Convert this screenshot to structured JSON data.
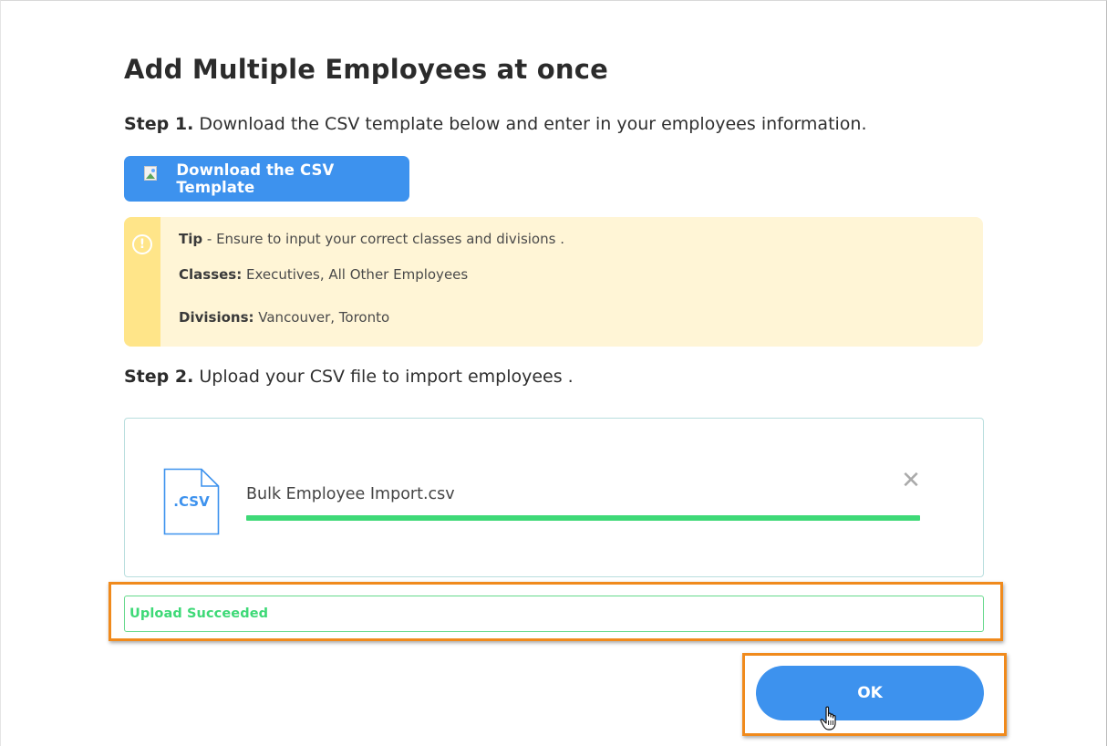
{
  "dialog": {
    "title": "Add Multiple Employees at once",
    "step1": {
      "label": "Step 1.",
      "text": " Download the CSV template below and enter in your employees information."
    },
    "download_button": {
      "label": "Download the CSV Template",
      "icon": "broken-image-icon"
    },
    "tip": {
      "icon": "alert-circle-icon",
      "tip_label": "Tip",
      "tip_text": " - Ensure to input your correct classes and divisions .",
      "classes_label": "Classes:",
      "classes_value": " Executives, All Other Employees",
      "divisions_label": "Divisions:",
      "divisions_value": " Vancouver, Toronto",
      "colors": {
        "background": "#fff5d6",
        "accent": "#ffe589"
      }
    },
    "step2": {
      "label": "Step 2.",
      "text": " Upload your CSV file to import employees ."
    },
    "upload": {
      "file_icon": "csv-file-icon",
      "file_icon_text": ".CSV",
      "file_name": "Bulk Employee Import.csv",
      "remove_icon": "close-icon",
      "progress_percent": 100,
      "progress_color": "#3ed977"
    },
    "status": {
      "text": "Upload Succeeded",
      "color": "#3ed977"
    },
    "ok_button": {
      "label": "OK"
    },
    "accent_color": "#3d92ee",
    "highlight_color": "#f08a1c",
    "cursor_icon": "hand-pointer-icon"
  }
}
